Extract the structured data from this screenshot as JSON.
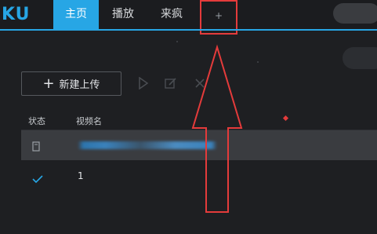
{
  "app": {
    "logo_text": "KU"
  },
  "nav": {
    "tabs": [
      {
        "label": "主页",
        "active": true
      },
      {
        "label": "播放",
        "active": false
      },
      {
        "label": "来疯",
        "active": false
      }
    ],
    "add_tab_label": "+"
  },
  "toolbar": {
    "upload_label": "新建上传",
    "icons": [
      "play-icon",
      "edit-icon",
      "delete-icon"
    ]
  },
  "table": {
    "headers": [
      "状态",
      "视频名"
    ],
    "rows": [
      {
        "status_icon": "file-icon",
        "name": "",
        "blurred": true
      },
      {
        "status_icon": "check-icon",
        "name": "1",
        "blurred": false
      }
    ]
  },
  "colors": {
    "accent": "#27a6e5",
    "background": "#1e1f22",
    "highlight_row": "#3a3c40",
    "annotation_red": "#e43b3b"
  }
}
